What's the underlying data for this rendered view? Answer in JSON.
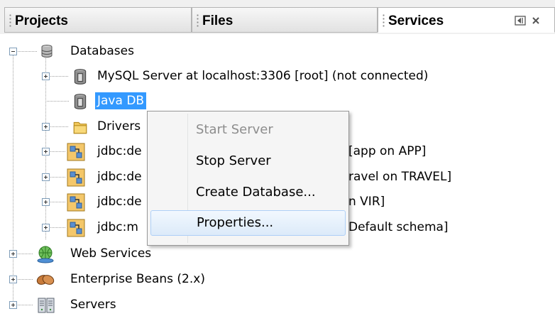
{
  "tabs": [
    {
      "label": "Projects",
      "active": false
    },
    {
      "label": "Files",
      "active": false
    },
    {
      "label": "Services",
      "active": true
    }
  ],
  "tab_controls": {
    "minimize_icon": "window-minimize-icon",
    "close_icon": "close-icon"
  },
  "tree": {
    "databases": {
      "label": "Databases",
      "icon": "database-icon"
    },
    "mysql": {
      "label": "MySQL Server at localhost:3306 [root] (not connected)",
      "icon": "db-server-icon"
    },
    "javadb": {
      "label": "Java DB",
      "icon": "db-server-icon",
      "selected": true
    },
    "drivers": {
      "label": "Drivers",
      "icon": "folder-icon"
    },
    "connections": [
      {
        "label_left": "jdbc:de",
        "label_right": "[app on APP]"
      },
      {
        "label_left": "jdbc:de",
        "label_right": "ravel on TRAVEL]"
      },
      {
        "label_left": "jdbc:de",
        "label_right": "n VIR]"
      },
      {
        "label_left": "jdbc:m",
        "label_right": "Default schema]"
      }
    ],
    "web_services": {
      "label": "Web Services",
      "icon": "web-services-icon"
    },
    "enterprise_beans": {
      "label": "Enterprise Beans (2.x)",
      "icon": "beans-icon"
    },
    "servers": {
      "label": "Servers",
      "icon": "servers-icon"
    }
  },
  "context_menu": {
    "items": [
      {
        "label": "Start Server",
        "enabled": false
      },
      {
        "label": "Stop Server",
        "enabled": true
      },
      {
        "label": "Create Database...",
        "enabled": true
      },
      {
        "label": "Properties...",
        "enabled": true,
        "hovered": true
      }
    ]
  },
  "colors": {
    "selection": "#3399ff",
    "menu_hover_border": "#aecff7"
  }
}
